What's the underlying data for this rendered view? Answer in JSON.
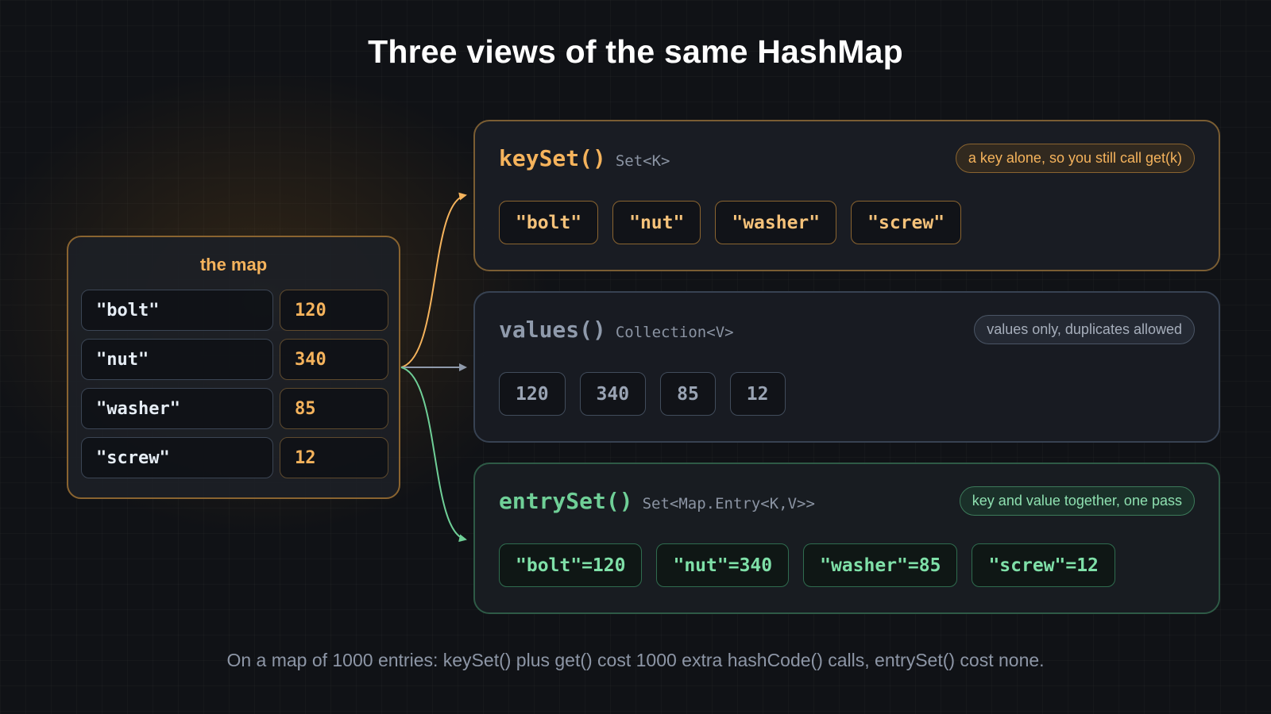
{
  "title": "Three views of the same HashMap",
  "map": {
    "title": "the map",
    "entries": [
      {
        "key": "\"bolt\"",
        "value": "120"
      },
      {
        "key": "\"nut\"",
        "value": "340"
      },
      {
        "key": "\"washer\"",
        "value": "85"
      },
      {
        "key": "\"screw\"",
        "value": "12"
      }
    ]
  },
  "views": {
    "keyset": {
      "method": "keySet()",
      "type": "Set<K>",
      "note": "a key alone, so you still call get(k)",
      "items": [
        "\"bolt\"",
        "\"nut\"",
        "\"washer\"",
        "\"screw\""
      ]
    },
    "values": {
      "method": "values()",
      "type": "Collection<V>",
      "note": "values only, duplicates allowed",
      "items": [
        "120",
        "340",
        "85",
        "12"
      ]
    },
    "entryset": {
      "method": "entrySet()",
      "type": "Set<Map.Entry<K,V>>",
      "note": "key and value together, one pass",
      "items": [
        "\"bolt\"=120",
        "\"nut\"=340",
        "\"washer\"=85",
        "\"screw\"=12"
      ]
    }
  },
  "footer": "On a map of 1000 entries: keySet() plus get() cost 1000 extra hashCode() calls, entrySet() cost none.",
  "colors": {
    "keyset": "#f5b35c",
    "values": "#8f9aab",
    "entryset": "#6fcf97",
    "map_border": "#8a6430"
  }
}
